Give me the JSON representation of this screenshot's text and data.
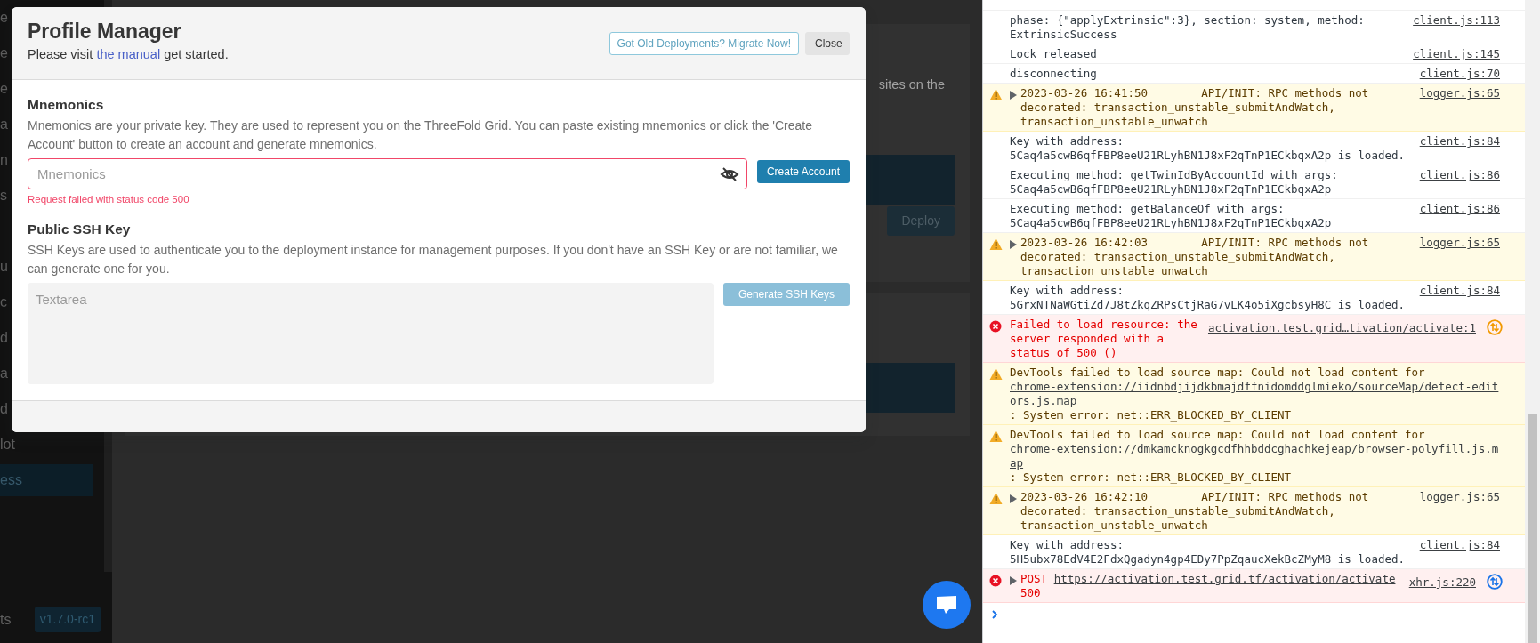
{
  "sidebar": {
    "groups": [
      {
        "items": [
          {
            "label": "e",
            "selected": false
          },
          {
            "label": "e",
            "selected": false
          },
          {
            "label": "e",
            "selected": false
          },
          {
            "label": "a",
            "selected": false
          },
          {
            "label": "n",
            "selected": false
          },
          {
            "label": "s",
            "selected": false
          }
        ]
      },
      {
        "items": [
          {
            "label": "u",
            "selected": false
          },
          {
            "label": "c",
            "selected": false
          },
          {
            "label": "d",
            "selected": false
          },
          {
            "label": "a",
            "selected": false
          },
          {
            "label": "d",
            "selected": false
          },
          {
            "label": "lot",
            "selected": false
          },
          {
            "label": "ess",
            "selected": true
          }
        ]
      }
    ],
    "footer_label": "ts",
    "version": "v1.7.0-rc1"
  },
  "main": {
    "text": "sites on the",
    "button": "Deploy"
  },
  "modal": {
    "title": "Profile Manager",
    "subtitle": {
      "before": "Please visit ",
      "link": "the manual",
      "after": " get started."
    },
    "buttons": [
      {
        "label": "Got Old Deployments? Migrate Now!",
        "kind": "outline"
      },
      {
        "label": "Close",
        "kind": "light"
      }
    ],
    "sections": [
      {
        "kind": "input",
        "label": "Mnemonics",
        "description": "Mnemonics are your private key. They are used to represent you on the ThreeFold Grid. You can paste existing mnemonics or click the 'Create Account' button to create an account and generate mnemonics.",
        "field": {
          "placeholder": "Mnemonics",
          "invalid": true
        },
        "button": {
          "label": "Create Account",
          "disabled": false
        },
        "error": "Request failed with status code 500"
      },
      {
        "kind": "textarea",
        "label": "Public SSH Key",
        "description": "SSH Keys are used to authenticate you to the deployment instance for management purposes. If you don't have an SSH Key or are not familiar, we can generate one for you.",
        "field": {
          "placeholder": "Textarea",
          "invalid": false
        },
        "button": {
          "label": "Generate SSH Keys",
          "disabled": true
        }
      }
    ]
  },
  "console": {
    "rows": [
      {
        "kind": "log",
        "message": "phase: {\"applyExtrinsic\":3}, section: system, method: ExtrinsicSuccess",
        "source": "client.js:113"
      },
      {
        "kind": "log",
        "message": "Lock released",
        "source": "client.js:145"
      },
      {
        "kind": "log",
        "message": "disconnecting",
        "source": "client.js:70"
      },
      {
        "kind": "warning",
        "expanded": false,
        "message": "2023-03-26 16:41:50        API/INIT: RPC methods not decorated: transaction_unstable_submitAndWatch, transaction_unstable_unwatch",
        "source": "logger.js:65"
      },
      {
        "kind": "log",
        "message": "Key with address: 5Caq4a5cwB6qfFBP8eeU21RLyhBN1J8xF2qTnP1ECkbqxA2p is loaded.",
        "source": "client.js:84"
      },
      {
        "kind": "log",
        "message": "Executing method: getTwinIdByAccountId with args: 5Caq4a5cwB6qfFBP8eeU21RLyhBN1J8xF2qTnP1ECkbqxA2p",
        "source": "client.js:86"
      },
      {
        "kind": "log",
        "message": "Executing method: getBalanceOf with args: 5Caq4a5cwB6qfFBP8eeU21RLyhBN1J8xF2qTnP1ECkbqxA2p",
        "source": "client.js:86"
      },
      {
        "kind": "warning",
        "expanded": false,
        "message": "2023-03-26 16:42:03        API/INIT: RPC methods not decorated: transaction_unstable_submitAndWatch, transaction_unstable_unwatch",
        "source": "logger.js:65"
      },
      {
        "kind": "log",
        "message": "Key with address: 5GrxNTNaWGtiZd7J8tZkqZRPsCtjRaG7vLK4o5iXgcbsyH8C is loaded.",
        "source": "client.js:84"
      },
      {
        "kind": "error",
        "message": "Failed to load resource: the server responded with a status of 500 ()",
        "source": "activation.test.grid…tivation/activate:1",
        "color": "#f29900"
      },
      {
        "kind": "warning",
        "segments": [
          {
            "kind": "text",
            "text": "DevTools failed to load source map: Could not load content for"
          },
          {
            "kind": "link",
            "text": "chrome-extension://iidnbdjijdkbmajdffnidomddglmieko/sourceMap/detect-editors.js.map"
          },
          {
            "kind": "text",
            "text": ": System error: net::ERR_BLOCKED_BY_CLIENT"
          }
        ]
      },
      {
        "kind": "warning",
        "segments": [
          {
            "kind": "text",
            "text": "DevTools failed to load source map: Could not load content for"
          },
          {
            "kind": "link",
            "text": "chrome-extension://dmkamcknogkgcdfhhbddcghachkejeap/browser-polyfill.js.map"
          },
          {
            "kind": "text",
            "text": ": System error: net::ERR_BLOCKED_BY_CLIENT"
          }
        ]
      },
      {
        "kind": "warning",
        "expanded": false,
        "message": "2023-03-26 16:42:10        API/INIT: RPC methods not decorated: transaction_unstable_submitAndWatch, transaction_unstable_unwatch",
        "source": "logger.js:65"
      },
      {
        "kind": "log",
        "message": "Key with address: 5H5ubx78EdV4E2FdxQgadyn4gp4EDy7PpZqaucXekBcZMyM8 is loaded.",
        "source": "client.js:84"
      },
      {
        "kind": "error",
        "expanded": false,
        "segments": [
          {
            "kind": "text",
            "text": "POST"
          },
          {
            "kind": "link",
            "text": "https://activation.test.grid.tf/activation/activate"
          },
          {
            "kind": "text",
            "text": "500"
          }
        ],
        "source": "xhr.js:220",
        "color": "#1a73e8"
      }
    ]
  }
}
